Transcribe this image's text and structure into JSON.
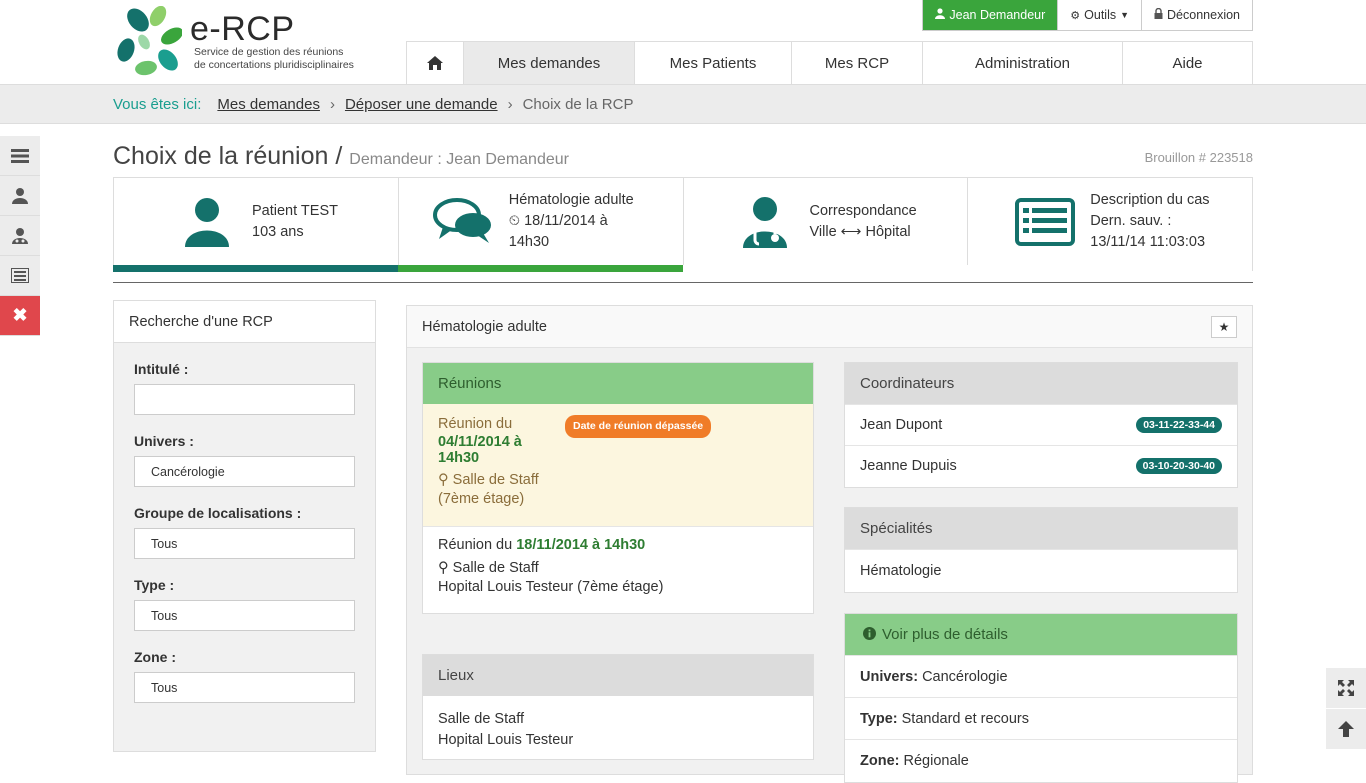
{
  "logo": {
    "brand": "e-RCP",
    "tagline_1": "Service de gestion des réunions",
    "tagline_2": "de concertations pluridisciplinaires"
  },
  "topbar": {
    "user": "Jean Demandeur",
    "tools": "Outils",
    "logout": "Déconnexion"
  },
  "nav": {
    "items": [
      "Mes demandes",
      "Mes Patients",
      "Mes RCP",
      "Administration",
      "Aide"
    ]
  },
  "breadcrumb": {
    "here": "Vous êtes ici:",
    "items": [
      "Mes demandes",
      "Déposer une demande",
      "Choix de la RCP"
    ]
  },
  "page": {
    "title": "Choix de la réunion",
    "slash": "/",
    "subtitle": "Demandeur : Jean Demandeur",
    "draft": "Brouillon # 223518"
  },
  "steps": [
    {
      "line1": "Patient TEST",
      "line2": "103 ans",
      "line3": ""
    },
    {
      "line1": "Hématologie adulte",
      "line2": "18/11/2014 à",
      "line3": "14h30"
    },
    {
      "line1": "Correspondance",
      "line2": "Ville ⟷ Hôpital",
      "line3": ""
    },
    {
      "line1": "Description du cas",
      "line2": "Dern. sauv. :",
      "line3": "13/11/14 11:03:03"
    }
  ],
  "search": {
    "title": "Recherche d'une RCP",
    "fields": [
      {
        "label": "Intitulé :",
        "value": ""
      },
      {
        "label": "Univers :",
        "value": "Cancérologie"
      },
      {
        "label": "Groupe de localisations :",
        "value": "Tous"
      },
      {
        "label": "Type :",
        "value": "Tous"
      },
      {
        "label": "Zone :",
        "value": "Tous"
      }
    ]
  },
  "main": {
    "title": "Hématologie adulte",
    "reunions": {
      "title": "Réunions",
      "past": {
        "prefix": "Réunion du",
        "date": "04/11/2014 à 14h30",
        "badge": "Date de réunion dépassée",
        "room": "Salle de Staff",
        "floor": "(7ème étage)"
      },
      "next": {
        "prefix": "Réunion du",
        "date": "18/11/2014 à 14h30",
        "room": "Salle de Staff",
        "place": "Hopital Louis Testeur (7ème étage)"
      }
    },
    "lieux": {
      "title": "Lieux",
      "line1": "Salle de Staff",
      "line2": "Hopital Louis Testeur"
    },
    "coordinateurs": {
      "title": "Coordinateurs",
      "people": [
        {
          "name": "Jean Dupont",
          "phone": "03-11-22-33-44"
        },
        {
          "name": "Jeanne Dupuis",
          "phone": "03-10-20-30-40"
        }
      ]
    },
    "specialites": {
      "title": "Spécialités",
      "value": "Hématologie"
    },
    "details": {
      "title": "Voir plus de détails",
      "rows": [
        {
          "key": "Univers:",
          "value": "Cancérologie"
        },
        {
          "key": "Type:",
          "value": "Standard et recours"
        },
        {
          "key": "Zone:",
          "value": "Régionale"
        }
      ]
    }
  },
  "colors": {
    "teal": "#14716b",
    "green": "#3aa53c",
    "red": "#e0474c",
    "orange": "#f07c28"
  }
}
